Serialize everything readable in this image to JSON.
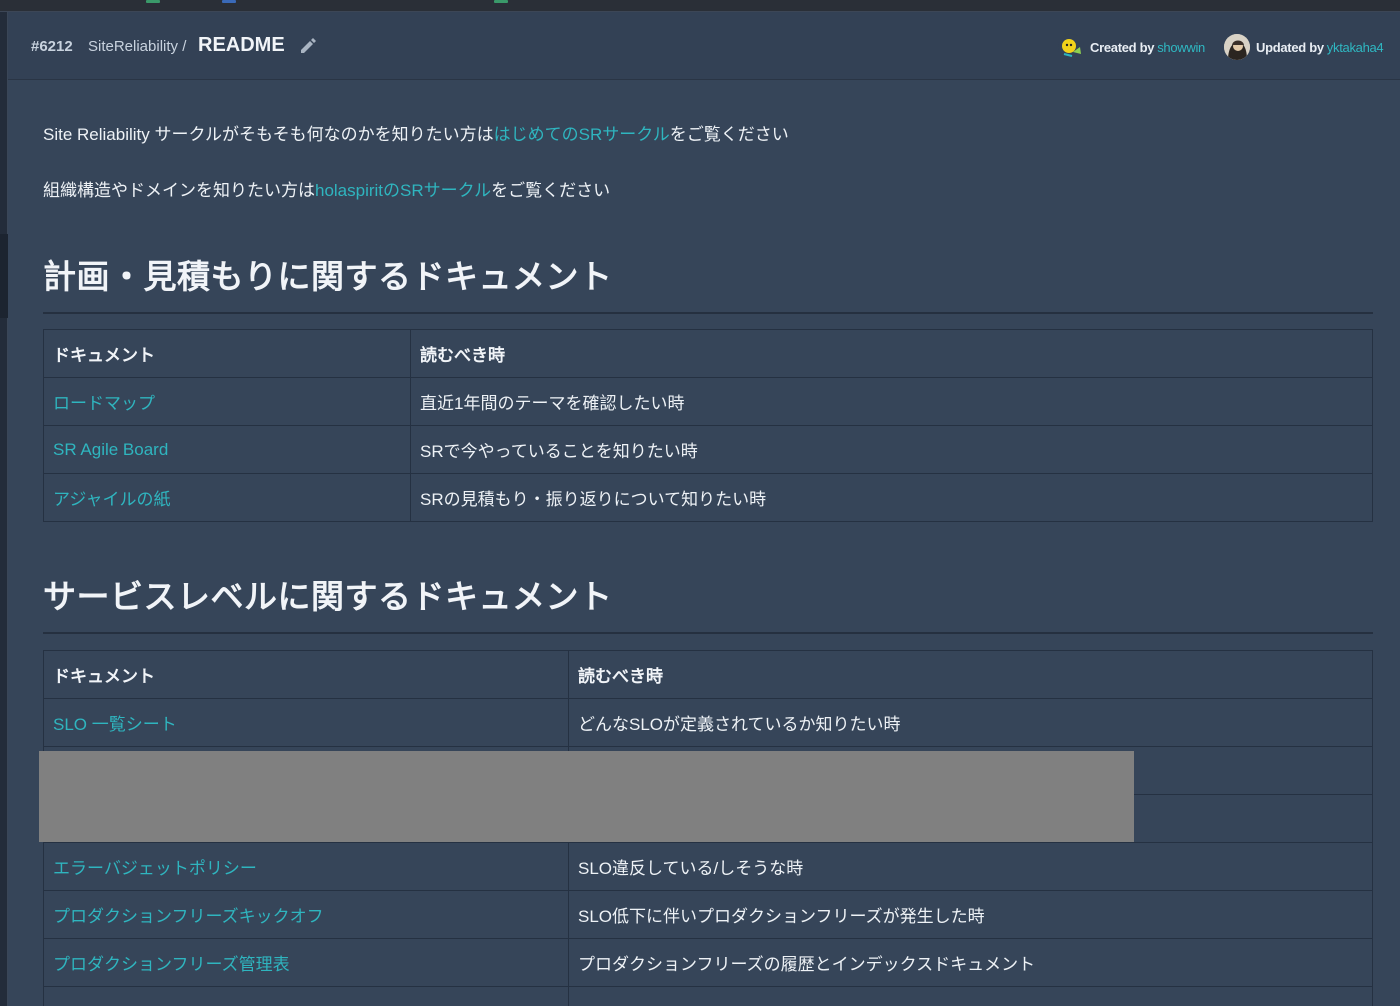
{
  "header": {
    "number": "#6212",
    "category": "SiteReliability /",
    "title": "README",
    "created_label": "Created by",
    "created_user": "showwin",
    "updated_label": "Updated by",
    "updated_user": "yktakaha4"
  },
  "intro": {
    "line1_prefix": "Site Reliability サークルがそもそも何なのかを知りたい方は",
    "line1_link": "はじめてのSRサークル",
    "line1_suffix": "をご覧ください",
    "line2_prefix": "組織構造やドメインを知りたい方は",
    "line2_link": "holaspiritのSRサークル",
    "line2_suffix": "をご覧ください"
  },
  "section1": {
    "heading": "計画・見積もりに関するドキュメント",
    "col_doc": "ドキュメント",
    "col_when": "読むべき時",
    "rows": [
      {
        "doc": "ロードマップ",
        "when": "直近1年間のテーマを確認したい時"
      },
      {
        "doc": "SR Agile Board",
        "when": "SRで今やっていることを知りたい時"
      },
      {
        "doc": "アジャイルの紙",
        "when": "SRの見積もり・振り返りについて知りたい時"
      }
    ]
  },
  "section2": {
    "heading": "サービスレベルに関するドキュメント",
    "col_doc": "ドキュメント",
    "col_when": "読むべき時",
    "rows": [
      {
        "doc": "SLO 一覧シート",
        "when": "どんなSLOが定義されているか知りたい時"
      },
      {
        "doc": "",
        "when": ""
      },
      {
        "doc": "",
        "when": ""
      },
      {
        "doc": "エラーバジェットポリシー",
        "when": "SLO違反している/しそうな時"
      },
      {
        "doc": "プロダクションフリーズキックオフ",
        "when": "SLO低下に伴いプロダクションフリーズが発生した時"
      },
      {
        "doc": "プロダクションフリーズ管理表",
        "when": "プロダクションフリーズの履歴とインデックスドキュメント"
      },
      {
        "doc": "",
        "when": ""
      }
    ]
  },
  "colors": {
    "background": "#364559",
    "link": "#2fb5bf",
    "redaction": "#808080"
  }
}
